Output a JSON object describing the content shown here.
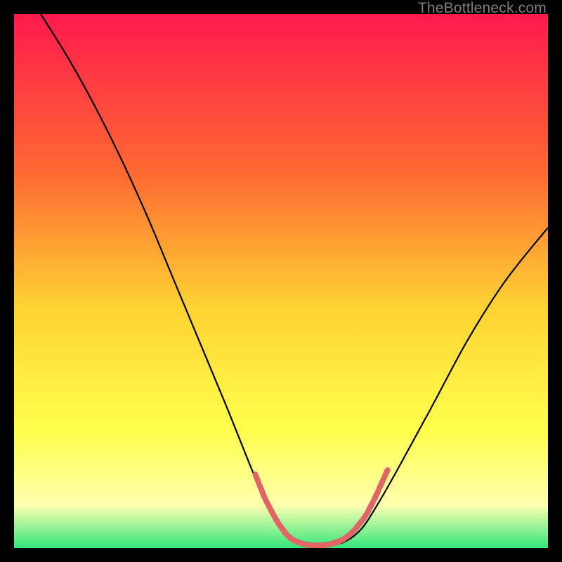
{
  "watermark": "TheBottleneck.com",
  "colors": {
    "gradient_top": "#ff1a4d",
    "gradient_mid1": "#ff6a33",
    "gradient_mid2": "#ffd333",
    "gradient_yellow": "#ffff4d",
    "gradient_pale": "#ffffb0",
    "gradient_green": "#33e67a",
    "curve": "#000000",
    "marker": "#e06666",
    "frame": "#000000"
  },
  "chart_data": {
    "type": "line",
    "title": "",
    "xlabel": "",
    "ylabel": "",
    "xlim": [
      0,
      100
    ],
    "ylim": [
      0,
      100
    ],
    "grid": false,
    "curve": [
      {
        "x": 5,
        "y": 100
      },
      {
        "x": 10,
        "y": 92
      },
      {
        "x": 15,
        "y": 83
      },
      {
        "x": 20,
        "y": 73
      },
      {
        "x": 25,
        "y": 62
      },
      {
        "x": 30,
        "y": 50
      },
      {
        "x": 35,
        "y": 38
      },
      {
        "x": 40,
        "y": 26
      },
      {
        "x": 44,
        "y": 16
      },
      {
        "x": 47,
        "y": 9
      },
      {
        "x": 50,
        "y": 4
      },
      {
        "x": 53,
        "y": 1.2
      },
      {
        "x": 56,
        "y": 0.5
      },
      {
        "x": 59,
        "y": 0.5
      },
      {
        "x": 62,
        "y": 1.2
      },
      {
        "x": 65,
        "y": 3.5
      },
      {
        "x": 68,
        "y": 8
      },
      {
        "x": 72,
        "y": 15
      },
      {
        "x": 78,
        "y": 26
      },
      {
        "x": 85,
        "y": 39
      },
      {
        "x": 92,
        "y": 50
      },
      {
        "x": 100,
        "y": 60
      }
    ],
    "markers": [
      {
        "x": 45.5,
        "y": 13.0
      },
      {
        "x": 46.3,
        "y": 11.0
      },
      {
        "x": 47.0,
        "y": 9.3
      },
      {
        "x": 47.8,
        "y": 7.7
      },
      {
        "x": 48.6,
        "y": 6.2
      },
      {
        "x": 49.4,
        "y": 4.8
      },
      {
        "x": 50.3,
        "y": 3.5
      },
      {
        "x": 51.3,
        "y": 2.3
      },
      {
        "x": 52.5,
        "y": 1.4
      },
      {
        "x": 53.8,
        "y": 0.9
      },
      {
        "x": 55.0,
        "y": 0.6
      },
      {
        "x": 56.2,
        "y": 0.5
      },
      {
        "x": 57.4,
        "y": 0.5
      },
      {
        "x": 58.6,
        "y": 0.6
      },
      {
        "x": 59.8,
        "y": 0.9
      },
      {
        "x": 61.0,
        "y": 1.3
      },
      {
        "x": 62.2,
        "y": 2.0
      },
      {
        "x": 63.4,
        "y": 3.0
      },
      {
        "x": 64.6,
        "y": 4.4
      },
      {
        "x": 65.8,
        "y": 6.0
      },
      {
        "x": 66.8,
        "y": 7.8
      },
      {
        "x": 67.8,
        "y": 9.8
      },
      {
        "x": 68.7,
        "y": 11.8
      },
      {
        "x": 69.6,
        "y": 13.8
      }
    ]
  }
}
